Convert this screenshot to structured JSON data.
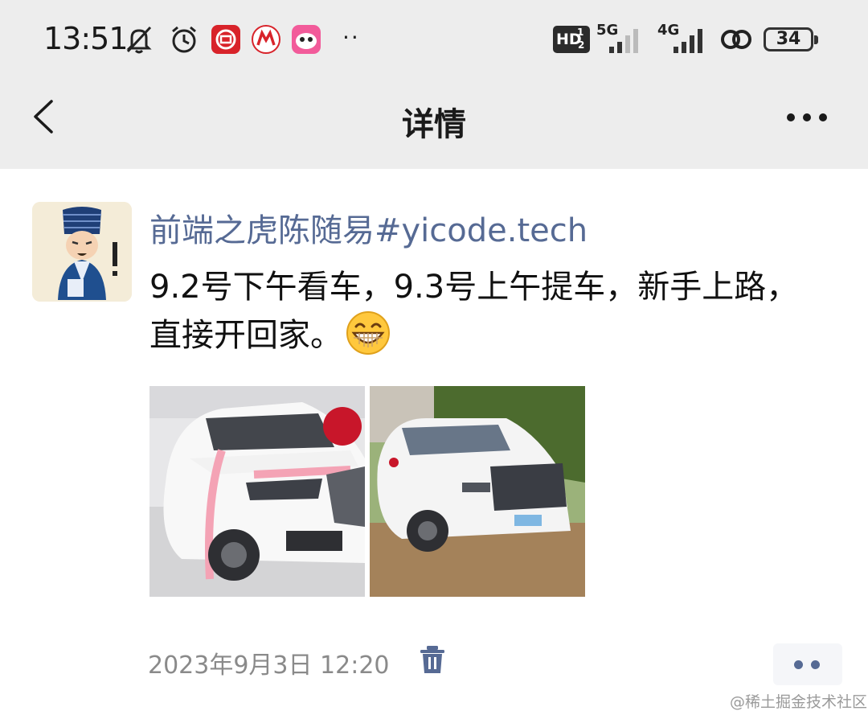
{
  "status_bar": {
    "time": "13:51",
    "icons": [
      "mute-icon",
      "alarm-icon",
      "bank-app-icon",
      "cmb-app-icon",
      "game-app-icon"
    ],
    "more_indicator": "··",
    "hd_label": "HD",
    "hd_sub": "1",
    "hd_sub2": "2",
    "network_1": "5G",
    "network_2": "4G",
    "battery": "34"
  },
  "nav": {
    "title": "详情"
  },
  "post": {
    "author": "前端之虎陈随易#yicode.tech",
    "text": "9.2号下午看车，9.3号上午提车，新手上路，直接开回家。",
    "emoji": "grinning-face-icon",
    "photos": [
      "car-photo-showroom",
      "car-photo-outdoor"
    ],
    "time": "2023年9月3日 12:20"
  },
  "colors": {
    "link": "#566a94",
    "bar_bg": "#ededed"
  },
  "watermark": "@稀土掘金技术社区"
}
